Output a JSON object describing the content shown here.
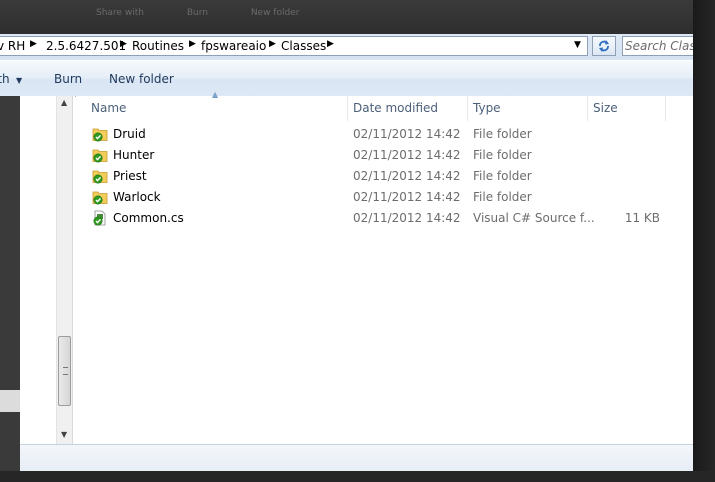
{
  "ghost_toolbar": [
    "Share with",
    "Burn",
    "New folder"
  ],
  "breadcrumb": {
    "partial": "v RH",
    "items": [
      "2.5.6427.501",
      "Routines",
      "fpswareaio",
      "Classes"
    ]
  },
  "search": {
    "placeholder": "Search Classes"
  },
  "command_bar": {
    "partial_item": "ith",
    "burn": "Burn",
    "new_folder": "New folder"
  },
  "columns": {
    "name": "Name",
    "date": "Date modified",
    "type": "Type",
    "size": "Size"
  },
  "files": [
    {
      "name": "Druid",
      "date": "02/11/2012 14:42",
      "type": "File folder",
      "size": "",
      "icon": "folder-icon"
    },
    {
      "name": "Hunter",
      "date": "02/11/2012 14:42",
      "type": "File folder",
      "size": "",
      "icon": "folder-icon"
    },
    {
      "name": "Priest",
      "date": "02/11/2012 14:42",
      "type": "File folder",
      "size": "",
      "icon": "folder-icon"
    },
    {
      "name": "Warlock",
      "date": "02/11/2012 14:42",
      "type": "File folder",
      "size": "",
      "icon": "folder-icon"
    },
    {
      "name": "Common.cs",
      "date": "02/11/2012 14:42",
      "type": "Visual C# Source f...",
      "size": "11 KB",
      "icon": "csharp-file-icon"
    }
  ],
  "colors": {
    "accent": "#1e395b",
    "status_check": "#2e9b1f",
    "folder": "#f2cd5a"
  }
}
